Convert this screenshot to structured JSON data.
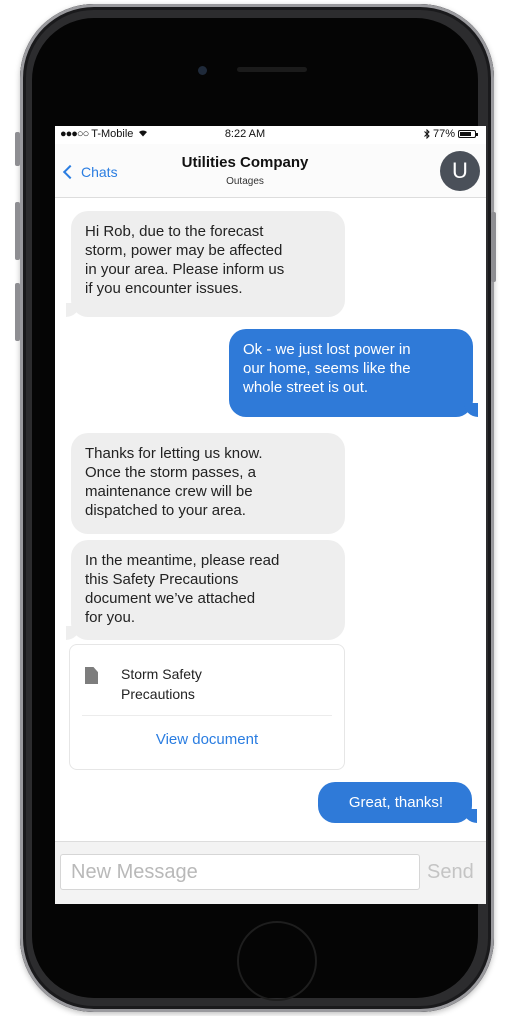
{
  "status_bar": {
    "carrier_dots": "●●●○○",
    "carrier": "T-Mobile",
    "time": "8:22 AM",
    "battery": "77%",
    "battery_level": 0.77
  },
  "nav": {
    "back_label": "Chats",
    "title": "Utilities Company",
    "subtitle": "Outages",
    "avatar_initial": "U"
  },
  "messages": [
    {
      "from": "them",
      "text": "Hi Rob, due to the forecast\nstorm, power may be affected\nin your area. Please inform us\nif you encounter issues."
    },
    {
      "from": "me",
      "text": "Ok - we just lost power in\nour home, seems like the\nwhole street is out."
    },
    {
      "from": "them",
      "text": "Thanks for letting us know.\nOnce the storm passes, a\nmaintenance crew will be\ndispatched to your area."
    },
    {
      "from": "them",
      "text": "In the meantime, please read\nthis Safety Precautions\ndocument we’ve attached\nfor you."
    },
    {
      "from": "me",
      "text": "Great, thanks!"
    }
  ],
  "attachment": {
    "title": "Storm Safety\nPrecautions",
    "action_label": "View document",
    "icon": "document-icon"
  },
  "composer": {
    "placeholder": "New Message",
    "send_label": "Send"
  },
  "colors": {
    "accent": "#2a7de1",
    "outgoing_bubble": "#2f7ad8",
    "incoming_bubble": "#eeeeee"
  }
}
